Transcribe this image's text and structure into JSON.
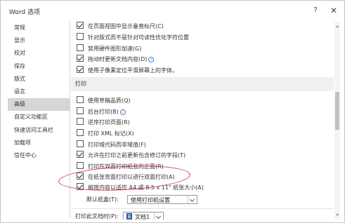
{
  "window": {
    "title": "Word 选项",
    "help_label": "?",
    "close_label": "✕"
  },
  "sidebar": {
    "items": [
      {
        "label": "常规"
      },
      {
        "label": "显示"
      },
      {
        "label": "校对"
      },
      {
        "label": "保存"
      },
      {
        "label": "版式"
      },
      {
        "label": "语言"
      },
      {
        "label": "高级",
        "selected": true
      },
      {
        "label": "自定义功能区"
      },
      {
        "label": "快速访问工具栏"
      },
      {
        "label": "加载项"
      },
      {
        "label": "信任中心"
      }
    ]
  },
  "display_options": [
    {
      "label": "在页面视图中显示垂直标尺(C)",
      "checked": true
    },
    {
      "label": "针对版式而不是针对可读性优化字符位置",
      "checked": false
    },
    {
      "label": "禁用硬件图形加速(G)",
      "checked": false
    },
    {
      "label": "拖动时更新文档内容(D)",
      "checked": true,
      "info": true
    },
    {
      "label": "使用子像素定位平滑屏幕上的字体。",
      "checked": true
    }
  ],
  "print_section": {
    "header": "打印",
    "options": [
      {
        "label": "使用草稿品质(Q)",
        "checked": false
      },
      {
        "label": "后台打印(B)",
        "checked": false,
        "info": true
      },
      {
        "label": "逆序打印页面(R)",
        "checked": false
      },
      {
        "label": "打印 XML 标记(X)",
        "checked": false
      },
      {
        "label": "打印域代码而非域值(F)",
        "checked": false
      },
      {
        "label": "允许在打印之前更新包含修订的字段(T)",
        "checked": true
      },
      {
        "label": "打印在双面打印纸张的正面(R)",
        "checked": false
      },
      {
        "label": "在纸张背面打印以进行双面打印(A)",
        "checked": true
      },
      {
        "label": "缩放内容以适应 A4 或 8.5 x 11\" 纸张大小(A)",
        "checked": true
      }
    ],
    "default_tray_label": "默认纸盒(T):",
    "default_tray_value": "使用打印机设置"
  },
  "print_document": {
    "label": "打印此文档时(P):",
    "value": "文档1"
  },
  "colors": {
    "annotation": "#d9343f",
    "selected_nav": "#d6d6d6",
    "section_bg": "#f0f0f0"
  }
}
